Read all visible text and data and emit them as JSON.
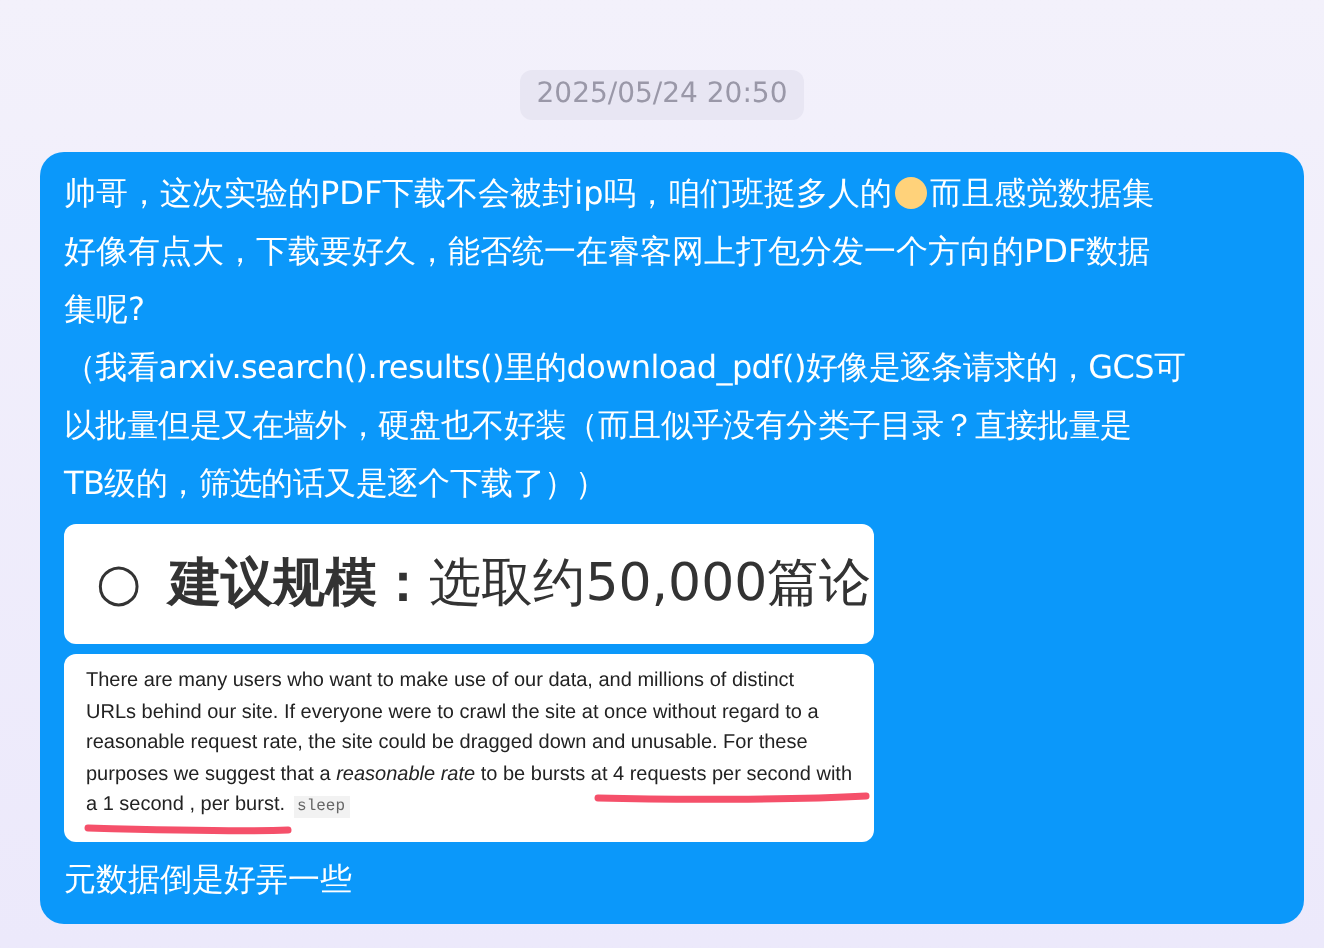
{
  "timestamp": "2025/05/24 20:50",
  "message": {
    "first_line_before_emoji": "帅哥，这次实验的PDF下载不会被封ip吗，咱们班挺多人的",
    "first_line_after_emoji": "而且感觉数据集",
    "lines": [
      "好像有点大，下载要好久，能否统一在睿客网上打包分发一个方向的PDF数据",
      "集呢?"
    ],
    "note_lines": [
      "（我看arxiv.search().results()里的download_pdf()好像是逐条请求的，GCS可",
      "以批量但是又在墙外，硬盘也不好装（而且似乎没有分类子目录？直接批量是",
      "TB级的，筛选的话又是逐个下载了））"
    ],
    "screenshot_1": {
      "bullet": "○",
      "label": "建议规模：",
      "text": "选取约50,000篇论"
    },
    "screenshot_2": {
      "lines": [
        "There are many users who want to make use of our data, and millions of distinct",
        "URLs behind our site. If everyone were to crawl the site at once without regard to a",
        "reasonable request rate, the site could be dragged down and unusable. For these",
        "purposes we suggest that a *reasonable rate* to be bursts at 4 requests per second with",
        "a 1 second , per burst."
      ],
      "code": "sleep"
    },
    "closing": "元数据倒是好弄一些"
  }
}
